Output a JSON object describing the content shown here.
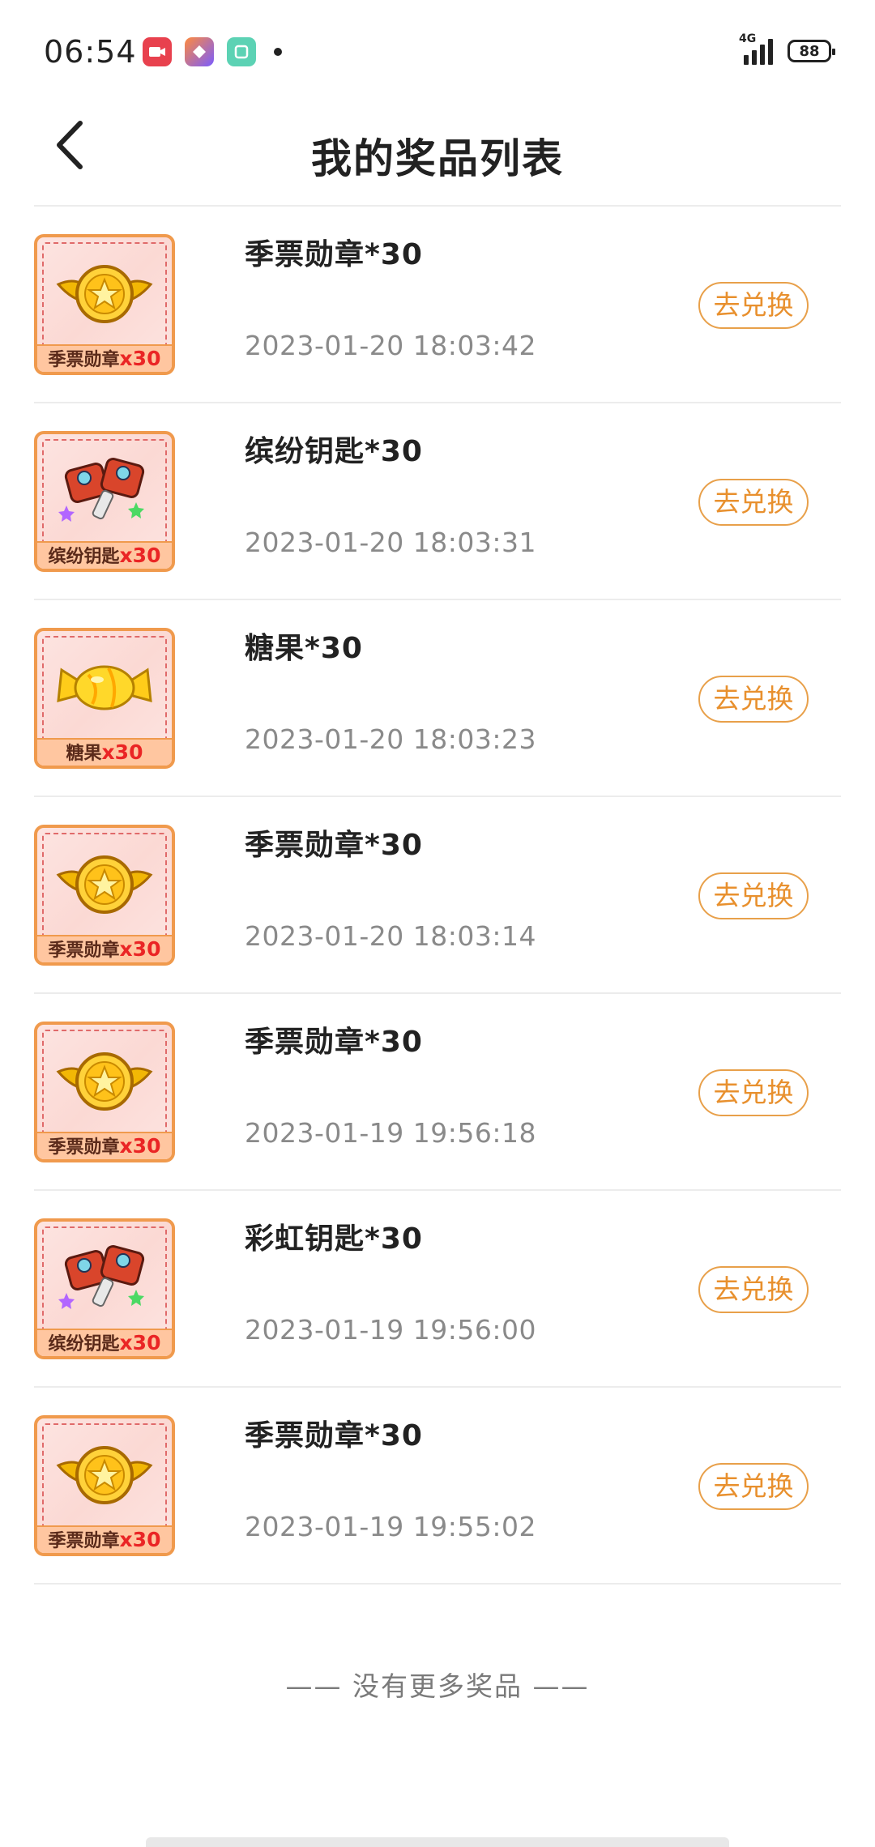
{
  "status_bar": {
    "time": "06:54",
    "network": "4G",
    "battery": "88"
  },
  "header": {
    "title": "我的奖品列表"
  },
  "prizes": [
    {
      "name": "季票勋章*30",
      "time": "2023-01-20 18:03:42",
      "icon": "medal-icon",
      "thumb_label": "季票勋章",
      "thumb_qty": "x30",
      "action": "去兑换"
    },
    {
      "name": "缤纷钥匙*30",
      "time": "2023-01-20 18:03:31",
      "icon": "key-icon",
      "thumb_label": "缤纷钥匙",
      "thumb_qty": "x30",
      "action": "去兑换"
    },
    {
      "name": "糖果*30",
      "time": "2023-01-20 18:03:23",
      "icon": "candy-icon",
      "thumb_label": "糖果",
      "thumb_qty": "x30",
      "action": "去兑换"
    },
    {
      "name": "季票勋章*30",
      "time": "2023-01-20 18:03:14",
      "icon": "medal-icon",
      "thumb_label": "季票勋章",
      "thumb_qty": "x30",
      "action": "去兑换"
    },
    {
      "name": "季票勋章*30",
      "time": "2023-01-19 19:56:18",
      "icon": "medal-icon",
      "thumb_label": "季票勋章",
      "thumb_qty": "x30",
      "action": "去兑换"
    },
    {
      "name": "彩虹钥匙*30",
      "time": "2023-01-19 19:56:00",
      "icon": "key-icon",
      "thumb_label": "缤纷钥匙",
      "thumb_qty": "x30",
      "action": "去兑换"
    },
    {
      "name": "季票勋章*30",
      "time": "2023-01-19 19:55:02",
      "icon": "medal-icon",
      "thumb_label": "季票勋章",
      "thumb_qty": "x30",
      "action": "去兑换"
    }
  ],
  "footer": {
    "no_more": "—— 没有更多奖品 ——"
  },
  "colors": {
    "accent": "#e8902e",
    "thumb_border": "#f09a4d",
    "divider": "#ececec"
  }
}
